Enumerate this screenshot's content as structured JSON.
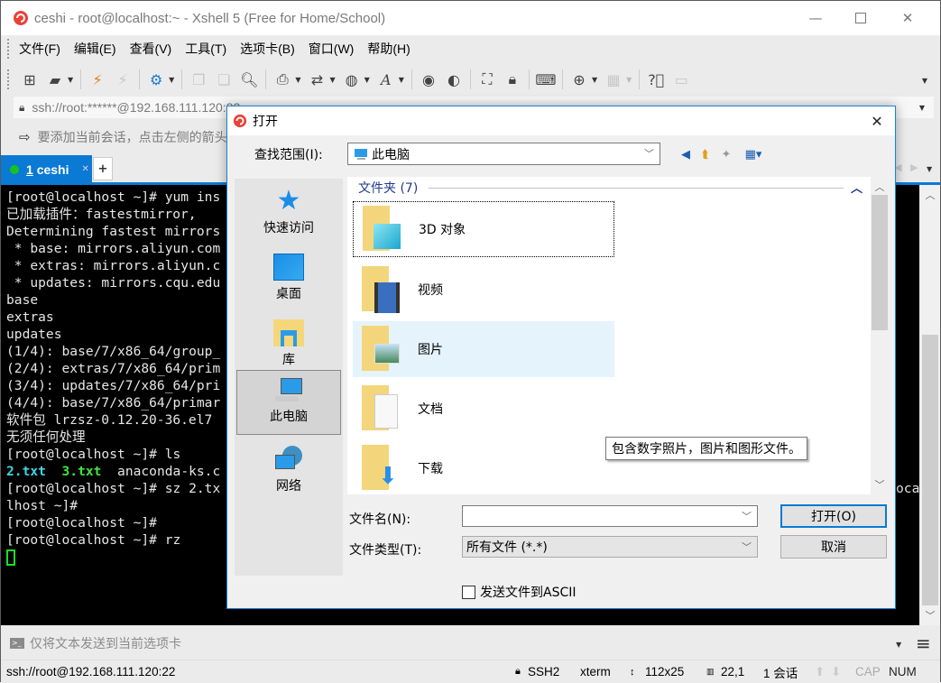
{
  "window": {
    "title": "ceshi - root@localhost:~ - Xshell 5 (Free for Home/School)",
    "controls": [
      "minimize",
      "maximize",
      "close"
    ]
  },
  "menu": [
    "文件(F)",
    "编辑(E)",
    "查看(V)",
    "工具(T)",
    "选项卡(B)",
    "窗口(W)",
    "帮助(H)"
  ],
  "toolbar": {
    "icons": [
      "new-session-icon",
      "open-folder-icon",
      "connect-icon",
      "disconnect-icon",
      "session-properties-icon",
      "copy-icon",
      "paste-icon",
      "find-icon",
      "print-icon",
      "transfer-icon",
      "globe-icon",
      "font-icon",
      "xshell-icon",
      "xftp-icon",
      "fullscreen-icon",
      "lock-icon",
      "keyboard-icon",
      "new-tab-icon",
      "layout-icon",
      "help-icon",
      "chat-icon"
    ]
  },
  "address": {
    "value": "ssh://root:******@192.168.111.120:22"
  },
  "hint": {
    "text": "要添加当前会话，点击左侧的箭头按钮。"
  },
  "tabs": [
    {
      "number": "1",
      "label": "ceshi",
      "active": true,
      "status_color": "#19c41a"
    }
  ],
  "terminal": {
    "lines": [
      "[root@localhost ~]# yum ins",
      "已加载插件：fastestmirror,",
      "Determining fastest mirrors",
      " * base: mirrors.aliyun.com",
      " * extras: mirrors.aliyun.c",
      " * updates: mirrors.cqu.edu",
      "base",
      "extras",
      "updates",
      "(1/4): base/7/x86_64/group_",
      "(2/4): extras/7/x86_64/prim",
      "(3/4): updates/7/x86_64/pri",
      "(4/4): base/7/x86_64/primar",
      "软件包 lrzsz-0.12.20-36.el7",
      "无须任何处理",
      "[root@localhost ~]# ls"
    ],
    "ls_files": [
      {
        "name": "2.txt",
        "color": "#3bd7e4"
      },
      {
        "name": "3.txt",
        "color": "#3be83b"
      },
      {
        "name": "anaconda-ks.c",
        "color": "#e6e6e6"
      }
    ],
    "lines_after": [
      "[root@localhost ~]# sz 2.tx",
      "lhost ~]#",
      "[root@localhost ~]#",
      "[root@localhost ~]# rz"
    ],
    "overflow_fragment": "oca"
  },
  "sendbar": {
    "placeholder": "仅将文本发送到当前选项卡"
  },
  "status": {
    "connection": "ssh://root@192.168.111.120:22",
    "protocol": "SSH2",
    "term_type": "xterm",
    "size": "112x25",
    "cursor_pos": "22,1",
    "sessions": "1 会话",
    "cap": "CAP",
    "num": "NUM"
  },
  "dialog": {
    "title": "打开",
    "look_in_label": "查找范围(I):",
    "look_in_value": "此电脑",
    "places": [
      {
        "label": "快速访问",
        "icon": "quick-access-star-icon"
      },
      {
        "label": "桌面",
        "icon": "desktop-icon"
      },
      {
        "label": "库",
        "icon": "library-icon"
      },
      {
        "label": "此电脑",
        "icon": "this-pc-icon",
        "selected": true
      },
      {
        "label": "网络",
        "icon": "network-icon"
      }
    ],
    "group_header": "文件夹 (7)",
    "folders": [
      {
        "name": "3D 对象",
        "icon": "3d-objects-folder-icon"
      },
      {
        "name": "视频",
        "icon": "videos-folder-icon"
      },
      {
        "name": "图片",
        "icon": "pictures-folder-icon"
      },
      {
        "name": "文档",
        "icon": "documents-folder-icon"
      },
      {
        "name": "下载",
        "icon": "downloads-folder-icon"
      }
    ],
    "tooltip": "包含数字照片，图片和图形文件。",
    "filename_label": "文件名(N):",
    "filename_value": "",
    "filetype_label": "文件类型(T):",
    "filetype_value": "所有文件 (*.*)",
    "open_button": "打开(O)",
    "cancel_button": "取消",
    "ascii_checkbox_label": "发送文件到ASCII",
    "ascii_checked": false
  }
}
